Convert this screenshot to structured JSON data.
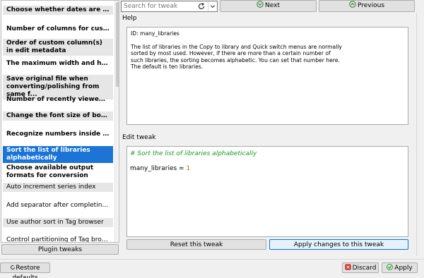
{
  "tweak_list": {
    "items": [
      {
        "label": "Choose whether dates are sorted ...",
        "bold": true,
        "shaded": true,
        "selected": false
      },
      {
        "label": "Number of columns for custom me...",
        "bold": true,
        "shaded": false,
        "selected": false
      },
      {
        "label": "Order of custom column(s) in edit metadata",
        "bold": true,
        "shaded": true,
        "selected": false
      },
      {
        "label": "The maximum width and height f...",
        "bold": true,
        "shaded": false,
        "selected": false
      },
      {
        "label": "Save original file when converting/polishing from same f...",
        "bold": true,
        "shaded": true,
        "selected": false
      },
      {
        "label": "Number of recently viewed books ...",
        "bold": true,
        "shaded": false,
        "selected": false
      },
      {
        "label": "Change the font size of book det...",
        "bold": true,
        "shaded": true,
        "selected": false
      },
      {
        "label": "Recognize numbers inside text wh...",
        "bold": true,
        "shaded": false,
        "selected": false
      },
      {
        "label": "Sort the list of libraries alphabetically",
        "bold": true,
        "shaded": false,
        "selected": true
      },
      {
        "label": "Choose available output formats for conversion",
        "bold": true,
        "shaded": false,
        "selected": false
      },
      {
        "label": "Auto increment series index",
        "bold": false,
        "shaded": true,
        "selected": false
      },
      {
        "label": "Add separator after completing an aut...",
        "bold": false,
        "shaded": false,
        "selected": false
      },
      {
        "label": "Use author sort in Tag browser",
        "bold": false,
        "shaded": true,
        "selected": false
      },
      {
        "label": "Control partitioning of Tag browser",
        "bold": false,
        "shaded": false,
        "selected": false
      }
    ]
  },
  "search": {
    "placeholder": "Search for tweak"
  },
  "nav": {
    "next_label": "Next",
    "previous_label": "Previous"
  },
  "help": {
    "section_label": "Help",
    "id_line": "ID: many_libraries",
    "text": "The list of libraries in the Copy to library and Quick switch menus are normally sorted by most used. However, if there are more than a certain number of such libraries, the sorting becomes alphabetic. You can set that number here. The default is ten libraries."
  },
  "edit": {
    "section_label": "Edit tweak",
    "code_comment": "# Sort the list of libraries alphabetically",
    "code_var": "many_libraries = ",
    "code_value": "1"
  },
  "buttons": {
    "plugin_tweaks": "Plugin tweaks",
    "reset": "Reset this tweak",
    "apply_changes": "Apply changes to this tweak",
    "restore_defaults": "Restore defaults",
    "discard": "Discard",
    "apply": "Apply"
  },
  "icons": {
    "refresh": "refresh-icon",
    "dropdown": "chevron-down-icon",
    "next": "arrow-down-circle-icon",
    "previous": "arrow-up-circle-icon",
    "restore": "restore-icon",
    "discard": "discard-icon",
    "apply": "check-circle-icon"
  },
  "colors": {
    "selection": "#1b74d6",
    "code_comment": "#1b9a2a",
    "code_number": "#b36b00",
    "accent_border": "#0078d7",
    "discard_red": "#d11a1a",
    "apply_green": "#2a9d3a"
  }
}
